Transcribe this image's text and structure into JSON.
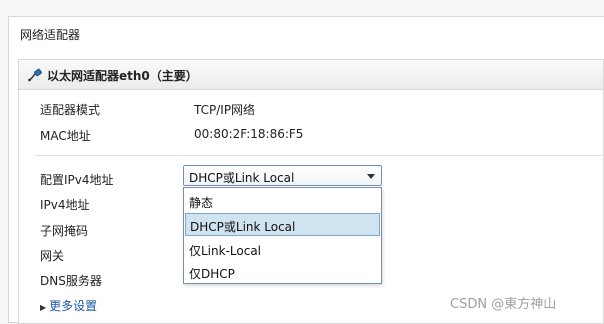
{
  "section": {
    "title": "网络适配器"
  },
  "adapter": {
    "title": "以太网适配器eth0（主要）",
    "icon": "network-cable-icon"
  },
  "fields": {
    "mode_label": "适配器模式",
    "mode_value": "TCP/IP网络",
    "mac_label": "MAC地址",
    "mac_value": "00:80:2F:18:86:F5",
    "ipv4_config_label": "配置IPv4地址",
    "ipv4_label": "IPv4地址",
    "subnet_label": "子网掩码",
    "gateway_label": "网关",
    "dns_label": "DNS服务器"
  },
  "ipv4_select": {
    "selected": "DHCP或Link Local",
    "options": [
      "静态",
      "DHCP或Link Local",
      "仅Link-Local",
      "仅DHCP"
    ],
    "highlighted_index": 1
  },
  "more_settings": {
    "label": "更多设置"
  },
  "watermark": "CSDN @東方神山"
}
